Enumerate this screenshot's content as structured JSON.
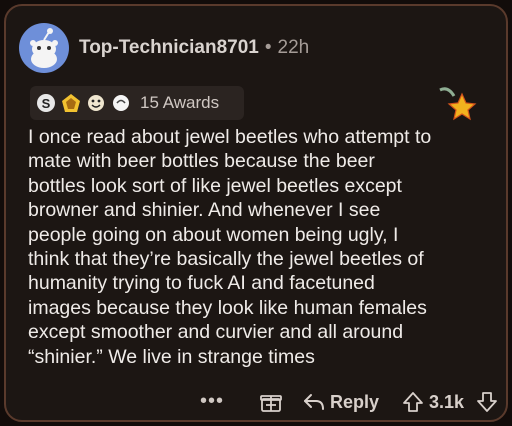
{
  "comment": {
    "username": "Top-Technician8701",
    "separator": "•",
    "timestamp": "22h",
    "awards_label": "15 Awards",
    "body": "I once read about jewel beetles who attempt to\nmate with beer bottles because the beer\nbottles look sort of like jewel beetles except\nbrowner and shinier. And whenever I see\npeople going on about women being ugly, I\nthink that they’re basically the jewel beetles of\nhumanity trying to fuck AI and facetuned\nimages because they look like human females\nexcept smoother and curvier and all around\n“shinier.” We live in strange times"
  },
  "actions": {
    "more": "•••",
    "reply_label": "Reply",
    "score": "3.1k"
  },
  "icons": {
    "avatar": "snoo-avatar",
    "awards": [
      "silver-award-icon",
      "gold-award-icon",
      "wholesome-award-icon",
      "helpful-award-icon"
    ],
    "corner": "star-award-icon",
    "gift": "gift-icon",
    "reply": "reply-arrow-icon",
    "upvote": "upvote-arrow-icon",
    "downvote": "downvote-arrow-icon"
  },
  "colors": {
    "background": "#1c1613",
    "border": "#5a3a2c",
    "avatar": "#6e8fd9",
    "text": "#efebe8",
    "muted": "#a59c97"
  }
}
